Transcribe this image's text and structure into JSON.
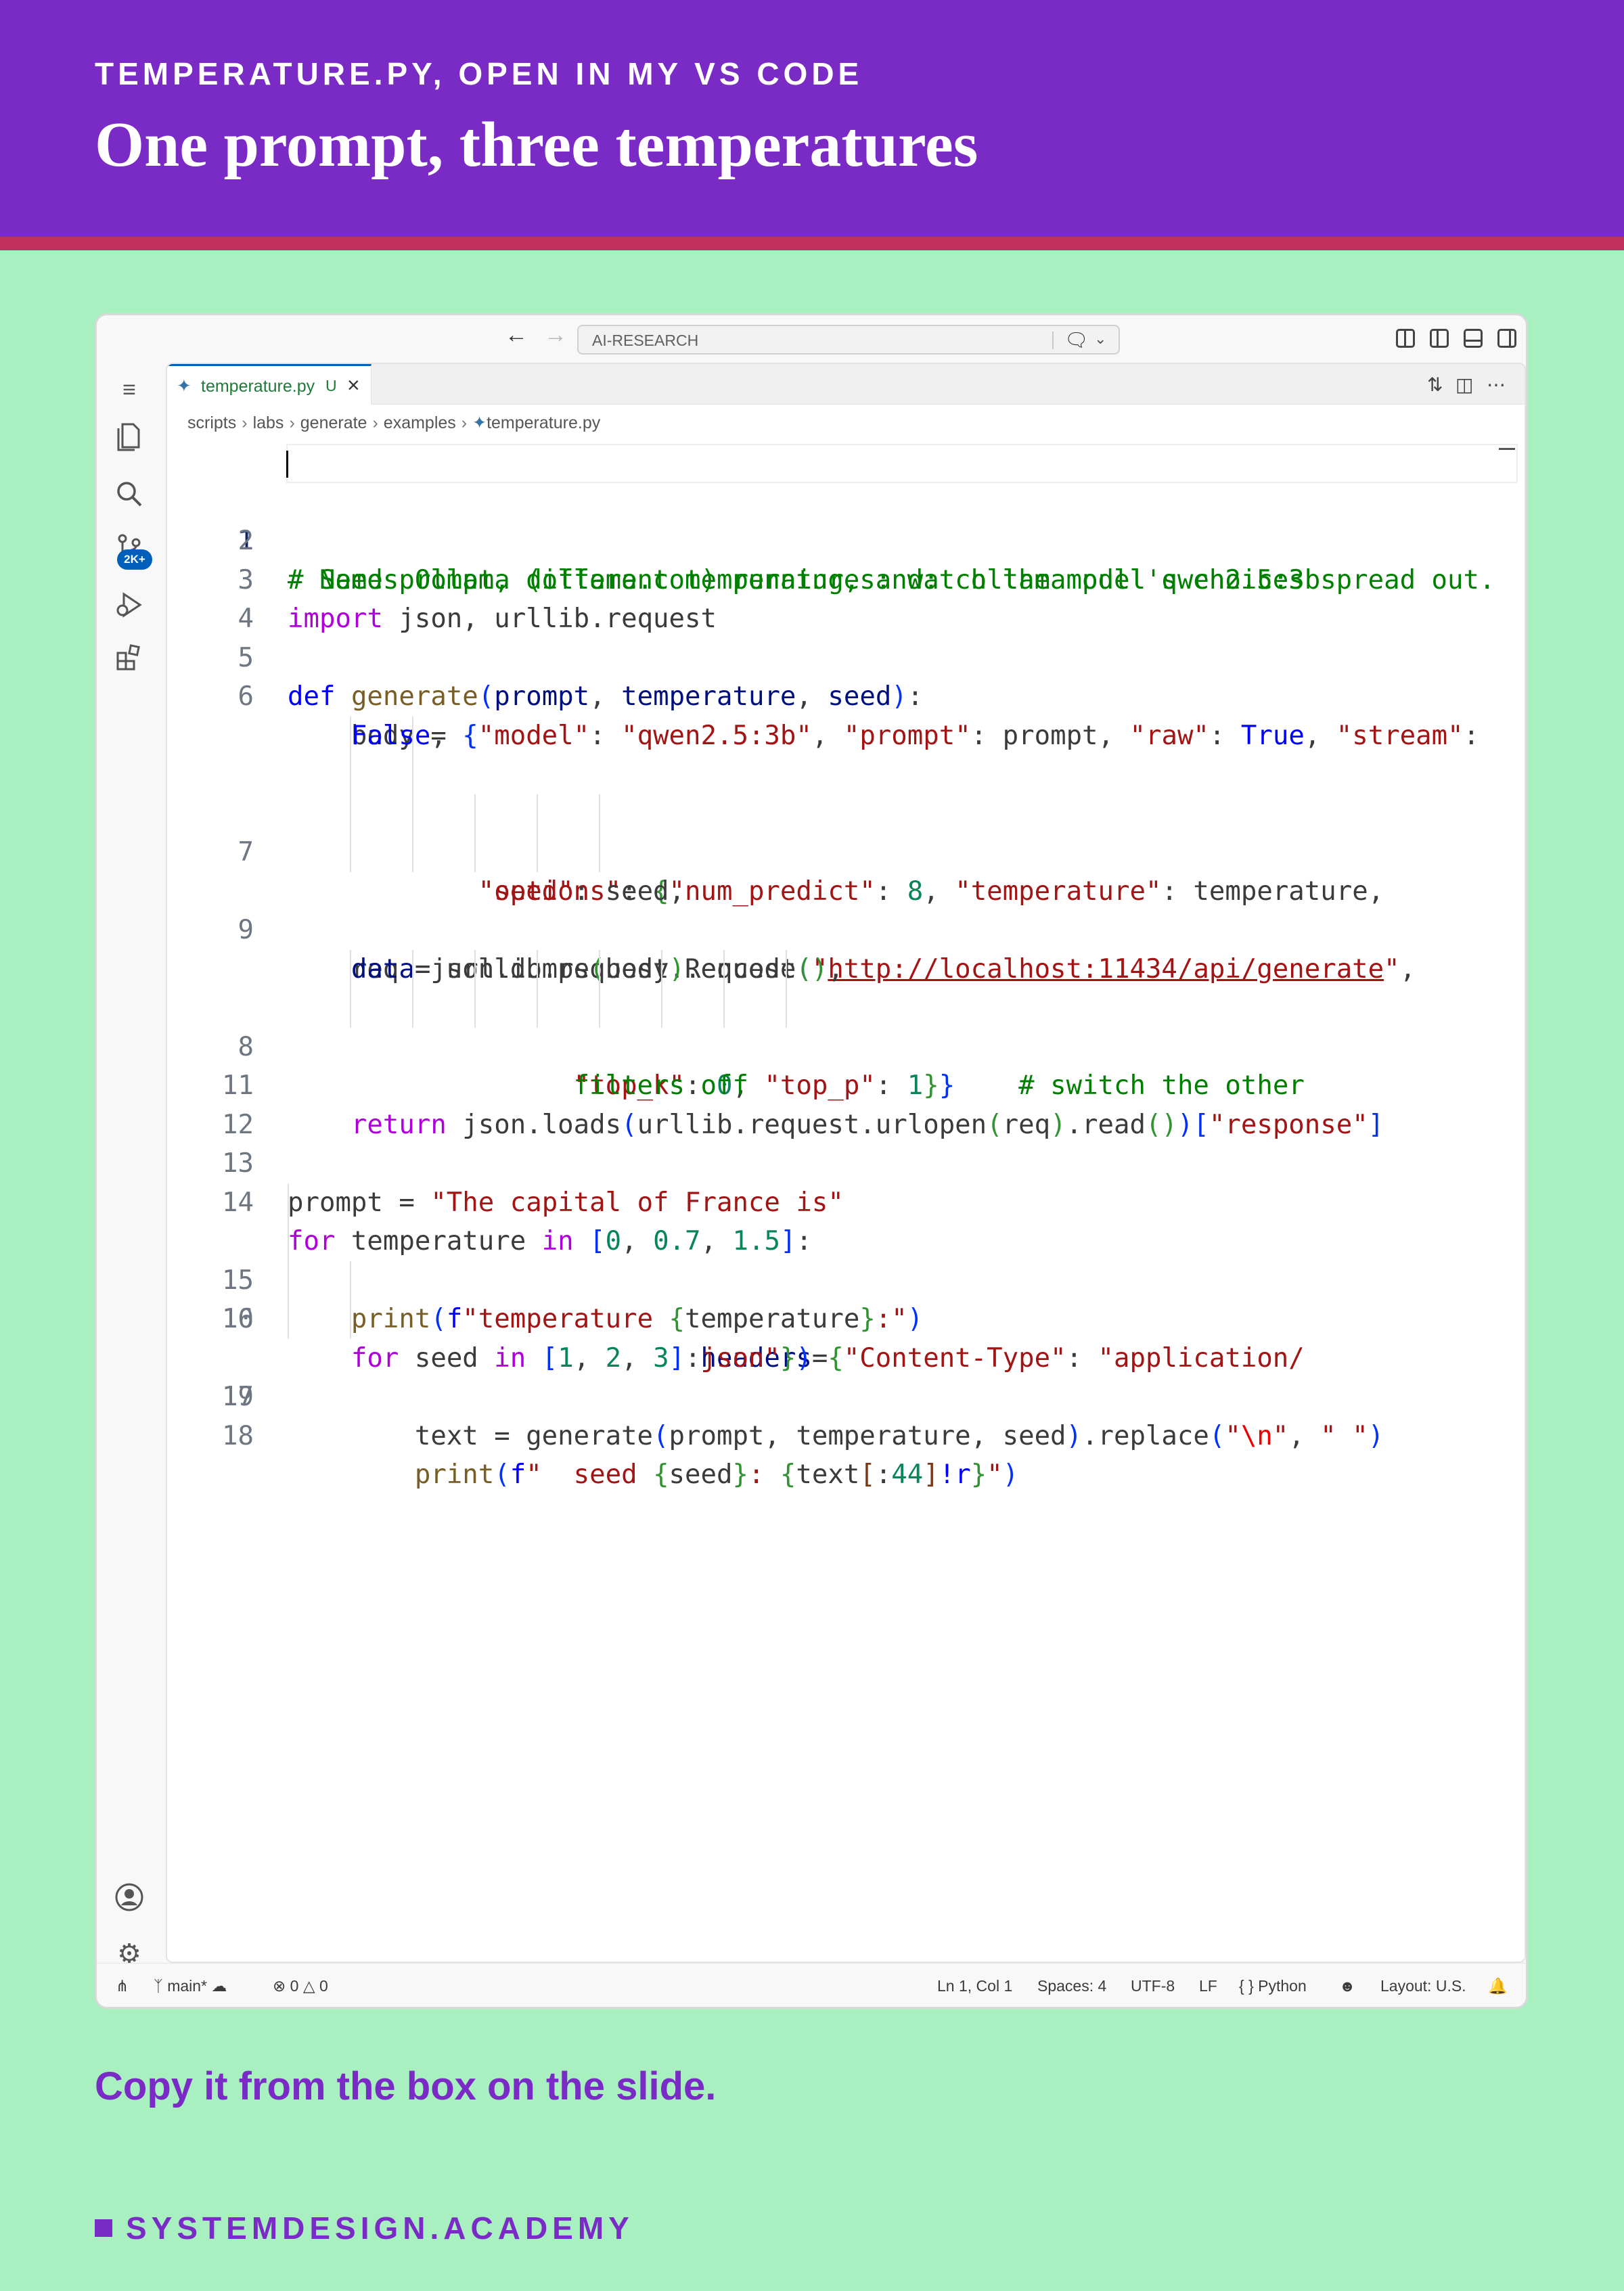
{
  "slide": {
    "kicker": "TEMPERATURE.PY, OPEN IN MY VS CODE",
    "title": "One prompt, three temperatures",
    "caption": "Copy it from the box on the slide.",
    "brand": "SYSTEMDESIGN.ACADEMY",
    "colors": {
      "header": "#7a2bc5",
      "stripe": "#c2315e",
      "background": "#a8f0c0"
    }
  },
  "titlebar": {
    "back_icon": "arrow-left-icon",
    "forward_icon": "arrow-right-icon",
    "command_center": "AI-RESEARCH",
    "chat_icon": "copilot-chat-icon"
  },
  "activity_bar": {
    "items": [
      "menu-icon",
      "explorer-icon",
      "search-icon",
      "source-control-icon",
      "run-debug-icon",
      "extensions-icon"
    ],
    "source_control_badge": "2K+",
    "bottom": [
      "accounts-icon",
      "manage-gear-icon"
    ]
  },
  "tab": {
    "label": "temperature.py",
    "status": "U",
    "icon": "python-file-icon"
  },
  "breadcrumb": [
    "scripts",
    "labs",
    "generate",
    "examples",
    "temperature.py"
  ],
  "code": {
    "line_numbers": [
      "1",
      "2",
      "3",
      "4",
      "5",
      "6",
      "7",
      "8",
      "9",
      "10",
      "11",
      "12",
      "13",
      "14",
      "15",
      "16",
      "17",
      "18",
      "19"
    ]
  },
  "statusbar": {
    "branch": "main*",
    "errors": "0",
    "warnings": "0",
    "position": "Ln 1, Col 1",
    "spaces": "Spaces: 4",
    "encoding": "UTF-8",
    "eol": "LF",
    "language": "Python",
    "layout": "Layout: U.S."
  }
}
